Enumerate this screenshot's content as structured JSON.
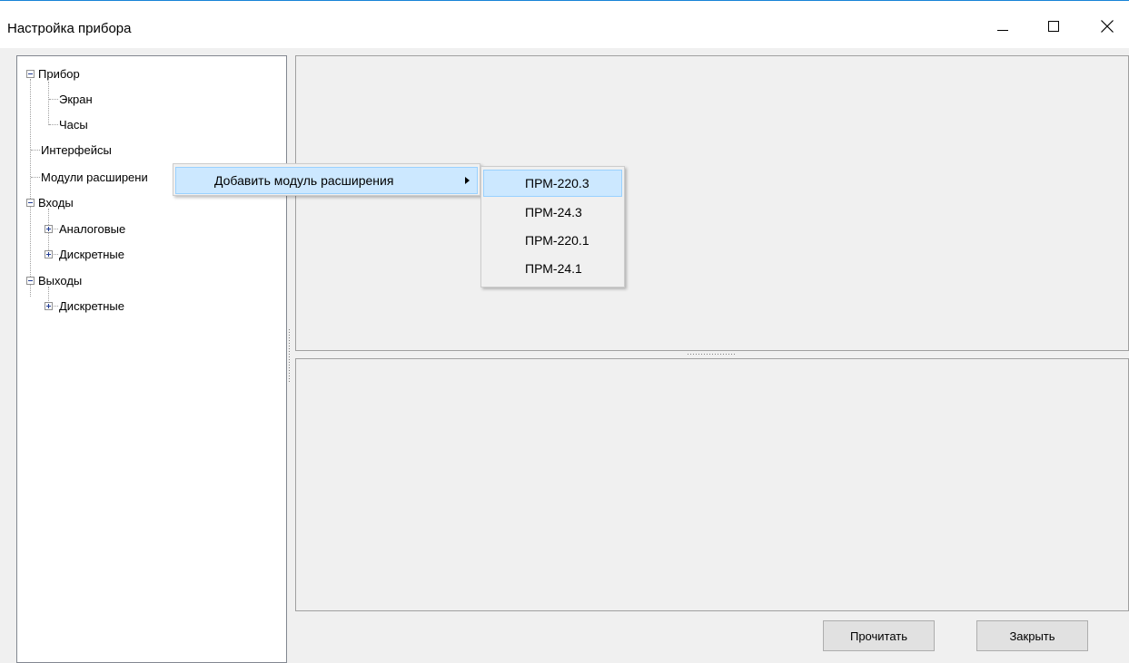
{
  "window": {
    "title": "Настройка прибора",
    "accent": "#1883d7"
  },
  "tree": {
    "items": [
      {
        "label": "Прибор",
        "expander": "minus"
      },
      {
        "label": "Экран"
      },
      {
        "label": "Часы"
      },
      {
        "label": "Интерфейсы"
      },
      {
        "label": "Модули расширени"
      },
      {
        "label": "Входы",
        "expander": "minus"
      },
      {
        "label": "Аналоговые",
        "expander": "plus"
      },
      {
        "label": "Дискретные",
        "expander": "plus"
      },
      {
        "label": "Выходы",
        "expander": "minus"
      },
      {
        "label": "Дискретные",
        "expander": "plus"
      }
    ]
  },
  "context_menu": {
    "item_label": "Добавить модуль расширения",
    "highlight": "#cce8ff"
  },
  "submenu": {
    "items": [
      "ПРМ-220.3",
      "ПРМ-24.3",
      "ПРМ-220.1",
      "ПРМ-24.1"
    ],
    "highlighted": "ПРМ-220.3"
  },
  "buttons": {
    "read": "Прочитать",
    "close": "Закрыть"
  }
}
